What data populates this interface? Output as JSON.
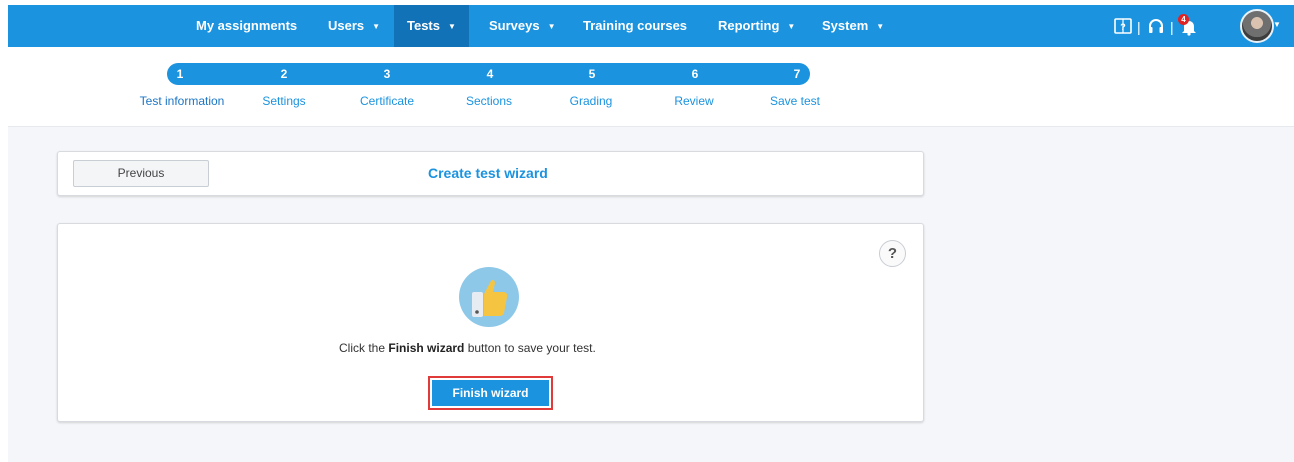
{
  "nav": {
    "items": [
      {
        "label": "My assignments",
        "caret": false,
        "active": false
      },
      {
        "label": "Users",
        "caret": true,
        "active": false
      },
      {
        "label": "Tests",
        "caret": true,
        "active": true
      },
      {
        "label": "Surveys",
        "caret": true,
        "active": false
      },
      {
        "label": "Training courses",
        "caret": false,
        "active": false
      },
      {
        "label": "Reporting",
        "caret": true,
        "active": false
      },
      {
        "label": "System",
        "caret": true,
        "active": false
      }
    ],
    "notification_count": "4",
    "icons": [
      "help-book-icon",
      "headset-icon",
      "bell-icon",
      "user-avatar"
    ]
  },
  "wizard": {
    "steps": [
      {
        "num": "1",
        "label": "Test information"
      },
      {
        "num": "2",
        "label": "Settings"
      },
      {
        "num": "3",
        "label": "Certificate"
      },
      {
        "num": "4",
        "label": "Sections"
      },
      {
        "num": "5",
        "label": "Grading"
      },
      {
        "num": "6",
        "label": "Review"
      },
      {
        "num": "7",
        "label": "Save test"
      }
    ],
    "previous_label": "Previous",
    "title": "Create test wizard",
    "message_prefix": "Click the ",
    "message_bold": "Finish wizard",
    "message_suffix": " button to save your test.",
    "finish_label": "Finish wizard",
    "help_symbol": "?"
  },
  "colors": {
    "primary": "#1b93df",
    "active_nav": "#1272b8",
    "highlight_border": "#e03a3a",
    "badge": "#e02323"
  }
}
